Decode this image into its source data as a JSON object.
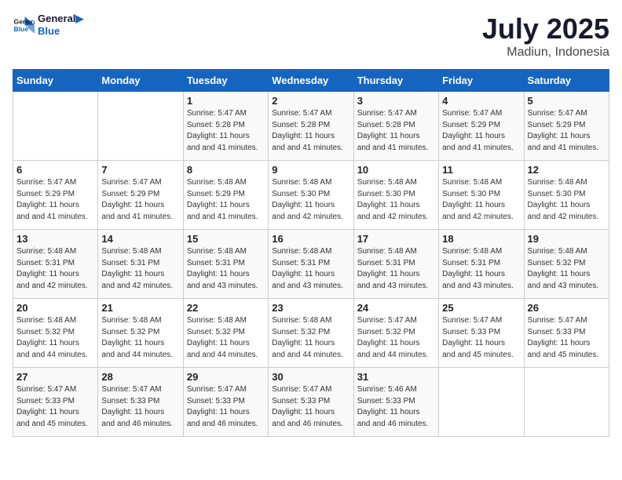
{
  "header": {
    "logo_line1": "General",
    "logo_line2": "Blue",
    "month_year": "July 2025",
    "location": "Madiun, Indonesia"
  },
  "weekdays": [
    "Sunday",
    "Monday",
    "Tuesday",
    "Wednesday",
    "Thursday",
    "Friday",
    "Saturday"
  ],
  "weeks": [
    [
      {
        "day": "",
        "sunrise": "",
        "sunset": "",
        "daylight": ""
      },
      {
        "day": "",
        "sunrise": "",
        "sunset": "",
        "daylight": ""
      },
      {
        "day": "1",
        "sunrise": "Sunrise: 5:47 AM",
        "sunset": "Sunset: 5:28 PM",
        "daylight": "Daylight: 11 hours and 41 minutes."
      },
      {
        "day": "2",
        "sunrise": "Sunrise: 5:47 AM",
        "sunset": "Sunset: 5:28 PM",
        "daylight": "Daylight: 11 hours and 41 minutes."
      },
      {
        "day": "3",
        "sunrise": "Sunrise: 5:47 AM",
        "sunset": "Sunset: 5:28 PM",
        "daylight": "Daylight: 11 hours and 41 minutes."
      },
      {
        "day": "4",
        "sunrise": "Sunrise: 5:47 AM",
        "sunset": "Sunset: 5:29 PM",
        "daylight": "Daylight: 11 hours and 41 minutes."
      },
      {
        "day": "5",
        "sunrise": "Sunrise: 5:47 AM",
        "sunset": "Sunset: 5:29 PM",
        "daylight": "Daylight: 11 hours and 41 minutes."
      }
    ],
    [
      {
        "day": "6",
        "sunrise": "Sunrise: 5:47 AM",
        "sunset": "Sunset: 5:29 PM",
        "daylight": "Daylight: 11 hours and 41 minutes."
      },
      {
        "day": "7",
        "sunrise": "Sunrise: 5:47 AM",
        "sunset": "Sunset: 5:29 PM",
        "daylight": "Daylight: 11 hours and 41 minutes."
      },
      {
        "day": "8",
        "sunrise": "Sunrise: 5:48 AM",
        "sunset": "Sunset: 5:29 PM",
        "daylight": "Daylight: 11 hours and 41 minutes."
      },
      {
        "day": "9",
        "sunrise": "Sunrise: 5:48 AM",
        "sunset": "Sunset: 5:30 PM",
        "daylight": "Daylight: 11 hours and 42 minutes."
      },
      {
        "day": "10",
        "sunrise": "Sunrise: 5:48 AM",
        "sunset": "Sunset: 5:30 PM",
        "daylight": "Daylight: 11 hours and 42 minutes."
      },
      {
        "day": "11",
        "sunrise": "Sunrise: 5:48 AM",
        "sunset": "Sunset: 5:30 PM",
        "daylight": "Daylight: 11 hours and 42 minutes."
      },
      {
        "day": "12",
        "sunrise": "Sunrise: 5:48 AM",
        "sunset": "Sunset: 5:30 PM",
        "daylight": "Daylight: 11 hours and 42 minutes."
      }
    ],
    [
      {
        "day": "13",
        "sunrise": "Sunrise: 5:48 AM",
        "sunset": "Sunset: 5:31 PM",
        "daylight": "Daylight: 11 hours and 42 minutes."
      },
      {
        "day": "14",
        "sunrise": "Sunrise: 5:48 AM",
        "sunset": "Sunset: 5:31 PM",
        "daylight": "Daylight: 11 hours and 42 minutes."
      },
      {
        "day": "15",
        "sunrise": "Sunrise: 5:48 AM",
        "sunset": "Sunset: 5:31 PM",
        "daylight": "Daylight: 11 hours and 43 minutes."
      },
      {
        "day": "16",
        "sunrise": "Sunrise: 5:48 AM",
        "sunset": "Sunset: 5:31 PM",
        "daylight": "Daylight: 11 hours and 43 minutes."
      },
      {
        "day": "17",
        "sunrise": "Sunrise: 5:48 AM",
        "sunset": "Sunset: 5:31 PM",
        "daylight": "Daylight: 11 hours and 43 minutes."
      },
      {
        "day": "18",
        "sunrise": "Sunrise: 5:48 AM",
        "sunset": "Sunset: 5:31 PM",
        "daylight": "Daylight: 11 hours and 43 minutes."
      },
      {
        "day": "19",
        "sunrise": "Sunrise: 5:48 AM",
        "sunset": "Sunset: 5:32 PM",
        "daylight": "Daylight: 11 hours and 43 minutes."
      }
    ],
    [
      {
        "day": "20",
        "sunrise": "Sunrise: 5:48 AM",
        "sunset": "Sunset: 5:32 PM",
        "daylight": "Daylight: 11 hours and 44 minutes."
      },
      {
        "day": "21",
        "sunrise": "Sunrise: 5:48 AM",
        "sunset": "Sunset: 5:32 PM",
        "daylight": "Daylight: 11 hours and 44 minutes."
      },
      {
        "day": "22",
        "sunrise": "Sunrise: 5:48 AM",
        "sunset": "Sunset: 5:32 PM",
        "daylight": "Daylight: 11 hours and 44 minutes."
      },
      {
        "day": "23",
        "sunrise": "Sunrise: 5:48 AM",
        "sunset": "Sunset: 5:32 PM",
        "daylight": "Daylight: 11 hours and 44 minutes."
      },
      {
        "day": "24",
        "sunrise": "Sunrise: 5:47 AM",
        "sunset": "Sunset: 5:32 PM",
        "daylight": "Daylight: 11 hours and 44 minutes."
      },
      {
        "day": "25",
        "sunrise": "Sunrise: 5:47 AM",
        "sunset": "Sunset: 5:33 PM",
        "daylight": "Daylight: 11 hours and 45 minutes."
      },
      {
        "day": "26",
        "sunrise": "Sunrise: 5:47 AM",
        "sunset": "Sunset: 5:33 PM",
        "daylight": "Daylight: 11 hours and 45 minutes."
      }
    ],
    [
      {
        "day": "27",
        "sunrise": "Sunrise: 5:47 AM",
        "sunset": "Sunset: 5:33 PM",
        "daylight": "Daylight: 11 hours and 45 minutes."
      },
      {
        "day": "28",
        "sunrise": "Sunrise: 5:47 AM",
        "sunset": "Sunset: 5:33 PM",
        "daylight": "Daylight: 11 hours and 46 minutes."
      },
      {
        "day": "29",
        "sunrise": "Sunrise: 5:47 AM",
        "sunset": "Sunset: 5:33 PM",
        "daylight": "Daylight: 11 hours and 46 minutes."
      },
      {
        "day": "30",
        "sunrise": "Sunrise: 5:47 AM",
        "sunset": "Sunset: 5:33 PM",
        "daylight": "Daylight: 11 hours and 46 minutes."
      },
      {
        "day": "31",
        "sunrise": "Sunrise: 5:46 AM",
        "sunset": "Sunset: 5:33 PM",
        "daylight": "Daylight: 11 hours and 46 minutes."
      },
      {
        "day": "",
        "sunrise": "",
        "sunset": "",
        "daylight": ""
      },
      {
        "day": "",
        "sunrise": "",
        "sunset": "",
        "daylight": ""
      }
    ]
  ]
}
